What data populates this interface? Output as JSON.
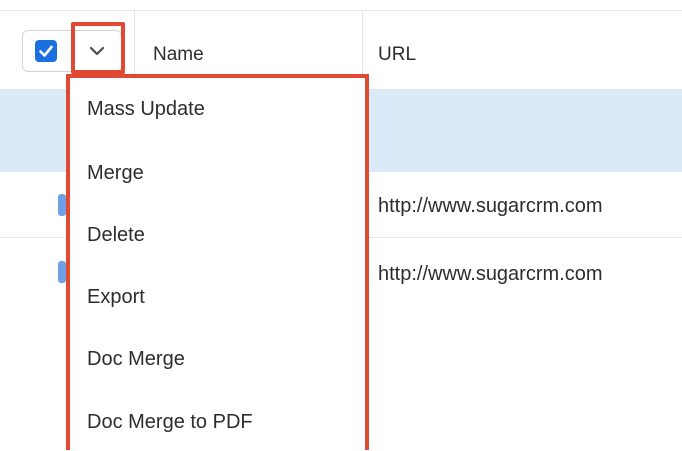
{
  "table": {
    "columns": [
      "Name",
      "URL"
    ],
    "rows": [
      {
        "url": ""
      },
      {
        "url": "http://www.sugarcrm.com"
      },
      {
        "url": "http://www.sugarcrm.com"
      }
    ]
  },
  "select_all": {
    "checked": true,
    "icon": "checkmark-icon",
    "toggle_icon": "chevron-down-icon"
  },
  "actions_menu": {
    "items": [
      "Mass Update",
      "Merge",
      "Delete",
      "Export",
      "Doc Merge",
      "Doc Merge to PDF"
    ]
  },
  "colors": {
    "accent": "#1b6fe0",
    "highlight": "#e04a32",
    "selected_row": "#dbeaf8"
  }
}
